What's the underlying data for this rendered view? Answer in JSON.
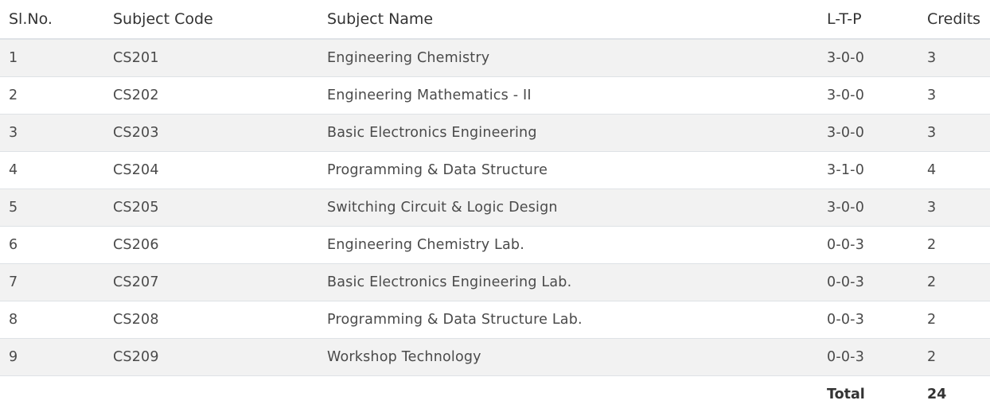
{
  "table": {
    "headers": [
      "Sl.No.",
      "Subject Code",
      "Subject Name",
      "L-T-P",
      "Credits"
    ],
    "rows": [
      [
        "1",
        "CS201",
        "Engineering Chemistry",
        "3-0-0",
        "3"
      ],
      [
        "2",
        "CS202",
        "Engineering Mathematics - II",
        "3-0-0",
        "3"
      ],
      [
        "3",
        "CS203",
        "Basic Electronics Engineering",
        "3-0-0",
        "3"
      ],
      [
        "4",
        "CS204",
        "Programming & Data Structure",
        "3-1-0",
        "4"
      ],
      [
        "5",
        "CS205",
        "Switching Circuit & Logic Design",
        "3-0-0",
        "3"
      ],
      [
        "6",
        "CS206",
        "Engineering Chemistry Lab.",
        "0-0-3",
        "2"
      ],
      [
        "7",
        "CS207",
        "Basic Electronics Engineering Lab.",
        "0-0-3",
        "2"
      ],
      [
        "8",
        "CS208",
        "Programming & Data Structure Lab.",
        "0-0-3",
        "2"
      ],
      [
        "9",
        "CS209",
        "Workshop Technology",
        "0-0-3",
        "2"
      ]
    ],
    "total_label": "Total",
    "total_credits": "24"
  },
  "colors": {
    "stripe": "#f2f2f2",
    "border": "#dee2e6",
    "text": "#333333"
  }
}
